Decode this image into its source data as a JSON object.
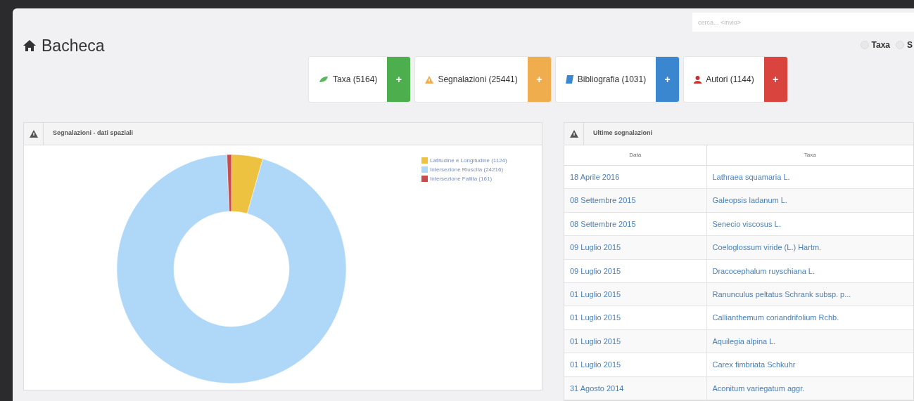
{
  "page_title": "Bacheca",
  "search": {
    "placeholder": "cerca... <invio>"
  },
  "search_scope": [
    {
      "label": "Taxa",
      "selected": false
    },
    {
      "label": "S",
      "selected": false
    }
  ],
  "stats": [
    {
      "kind": "taxa",
      "label": "Taxa (5164)",
      "plus": "+",
      "color": "#4cae4c"
    },
    {
      "kind": "warning",
      "label": "Segnalazioni (25441)",
      "plus": "+",
      "color": "#f0ad4e"
    },
    {
      "kind": "book",
      "label": "Bibliografia (1031)",
      "plus": "+",
      "color": "#3a87cf"
    },
    {
      "kind": "user",
      "label": "Autori (1144)",
      "plus": "+",
      "color": "#d9443f"
    }
  ],
  "spatial_panel": {
    "title": "Segnalazioni - dati spaziali",
    "chart_data": {
      "type": "donut",
      "categories": [
        "Latitudine e Longitudine (1124)",
        "Intersezione Riuscita (24216)",
        "Intersezione Fallita (161)"
      ],
      "values": [
        1124,
        24216,
        161
      ],
      "colors": [
        "#edc240",
        "#afd8f8",
        "#cb4b4b"
      ]
    }
  },
  "latest_panel": {
    "title": "Ultime segnalazioni",
    "columns": [
      "Data",
      "Taxa"
    ],
    "rows": [
      {
        "date": "18 Aprile 2016",
        "taxon": "Lathraea squamaria L."
      },
      {
        "date": "08 Settembre 2015",
        "taxon": "Galeopsis ladanum L."
      },
      {
        "date": "08 Settembre 2015",
        "taxon": "Senecio viscosus L."
      },
      {
        "date": "09 Luglio 2015",
        "taxon": "Coeloglossum viride (L.) Hartm."
      },
      {
        "date": "09 Luglio 2015",
        "taxon": "Dracocephalum ruyschiana L."
      },
      {
        "date": "01 Luglio 2015",
        "taxon": "Ranunculus peltatus Schrank subsp. p..."
      },
      {
        "date": "01 Luglio 2015",
        "taxon": "Callianthemum coriandrifolium Rchb."
      },
      {
        "date": "01 Luglio 2015",
        "taxon": "Aquilegia alpina L."
      },
      {
        "date": "01 Luglio 2015",
        "taxon": "Carex fimbriata Schkuhr"
      },
      {
        "date": "31 Agosto 2014",
        "taxon": "Aconitum variegatum aggr."
      }
    ]
  }
}
